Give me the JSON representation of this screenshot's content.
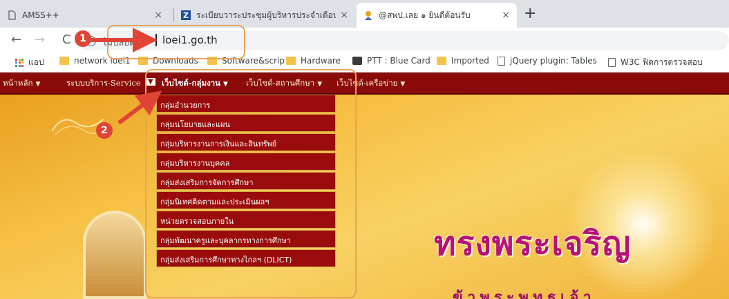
{
  "tabs": [
    {
      "title": "AMSS++",
      "active": false
    },
    {
      "title": "ระเบียบวาระประชุมผู้บริหารประจำเดือน",
      "active": false
    },
    {
      "title": "@สพป.เลย ๑ ยินดีต้อนรับ",
      "active": true
    }
  ],
  "tab_close": "×",
  "new_tab": "+",
  "nav": {
    "back": "←",
    "forward": "→",
    "reload": "C"
  },
  "address": {
    "secure_label": "ไม่ปลอดภัย",
    "url": "loei1.go.th"
  },
  "bookmarks": [
    {
      "label": "แอป",
      "icon": "apps-icon"
    },
    {
      "label": "network loei1",
      "icon": "folder-icon"
    },
    {
      "label": "Downloads",
      "icon": "folder-icon"
    },
    {
      "label": "Software&scrip",
      "icon": "folder-icon"
    },
    {
      "label": "Hardware",
      "icon": "folder-icon"
    },
    {
      "label": "PTT : Blue Card",
      "icon": "card-icon"
    },
    {
      "label": "Imported",
      "icon": "folder-icon"
    },
    {
      "label": "jQuery plugin: Tables",
      "icon": "page-icon"
    },
    {
      "label": "W3C ฟิดการตรวจสอบ",
      "icon": "page-icon"
    }
  ],
  "menu": [
    {
      "label": "หน้าหลัก"
    },
    {
      "label": "ระบบบริการ-Service"
    },
    {
      "label": "เว็บไซต์-กลุ่มงาน"
    },
    {
      "label": "เว็บไซต์-สถานศึกษา"
    },
    {
      "label": "เว็บไซต์-เครือข่าย"
    }
  ],
  "menu_caret": "▼",
  "dropdown": [
    "กลุ่มอำนวยการ",
    "กลุ่มนโยบายและแผน",
    "กลุ่มบริหารงานการเงินและสินทรัพย์",
    "กลุ่มบริหารงานบุคคล",
    "กลุ่มส่งเสริมการจัดการศึกษา",
    "กลุ่มนิเทศติดตามและประเมินผลฯ",
    "หน่วยตรวจสอบภายใน",
    "กลุ่มพัฒนาครูและบุคลากรทางการศึกษา",
    "กลุ่มส่งเสริมการศึกษาทางไกลฯ (DLICT)"
  ],
  "banner": {
    "headline": "ทรงพระเจริญ",
    "subline": "ข้าพระพุทธเจ้า"
  },
  "annotations": {
    "step1": "1",
    "step2": "2"
  },
  "colors": {
    "menubar": "#8b0a0a",
    "highlight": "#e8a35a",
    "badge": "#e04437"
  }
}
